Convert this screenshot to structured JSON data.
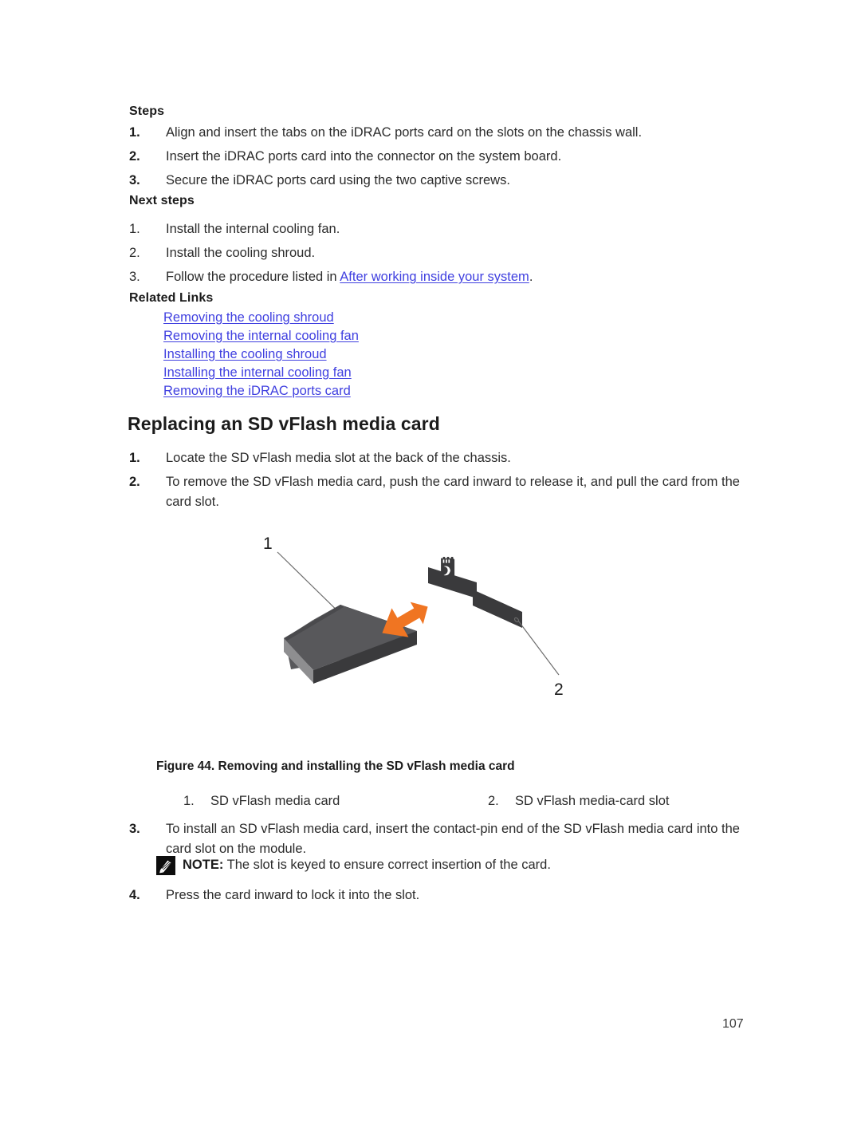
{
  "document": {
    "page_number": "107"
  },
  "steps_section": {
    "heading": "Steps",
    "items": [
      "Align and insert the tabs on the iDRAC ports card on the slots on the chassis wall.",
      "Insert the iDRAC ports card into the connector on the system board.",
      "Secure the iDRAC ports card using the two captive screws."
    ],
    "markers": [
      "1.",
      "2.",
      "3."
    ]
  },
  "next_steps_section": {
    "heading": "Next steps",
    "markers": [
      "1.",
      "2.",
      "3."
    ],
    "items": [
      "Install the internal cooling fan.",
      "Install the cooling shroud."
    ],
    "item3_prefix": "Follow the procedure listed in ",
    "item3_link": "After working inside your system",
    "item3_suffix": "."
  },
  "related_links": {
    "heading": "Related Links",
    "links": [
      "Removing the cooling shroud",
      "Removing the internal cooling fan",
      "Installing the cooling shroud",
      "Installing the internal cooling fan",
      "Removing the iDRAC ports card"
    ]
  },
  "section": {
    "title": "Replacing an SD vFlash media card",
    "markers": [
      "1.",
      "2.",
      "3.",
      "4."
    ],
    "step1": "Locate the SD vFlash media slot at the back of the chassis.",
    "step2": "To remove the SD vFlash media card, push the card inward to release it, and pull the card from the card slot.",
    "step3": "To install an SD vFlash media card, insert the contact-pin end of the SD vFlash media card into the card slot on the module.",
    "step4": "Press the card inward to lock it into the slot."
  },
  "note": {
    "label": "NOTE:",
    "text": " The slot is keyed to ensure correct insertion of the card.",
    "icon": "note-pencil-icon"
  },
  "figure": {
    "caption": "Figure 44. Removing and installing the SD vFlash media card",
    "callouts": [
      {
        "number": "1"
      },
      {
        "number": "2"
      }
    ],
    "legend": [
      {
        "marker": "1.",
        "label": "SD vFlash media card"
      },
      {
        "marker": "2.",
        "label": "SD vFlash media-card slot"
      }
    ],
    "icons": {
      "sd_card_glyph": "sd-card-icon",
      "arrow": "double-headed-arrow-icon"
    },
    "colors": {
      "card_top": "#58585b",
      "card_side": "#3a3a3c",
      "card_edge_light": "#8e8e90",
      "slot_bar": "#3a3a3c",
      "arrow_orange": "#f07522",
      "leader_line": "#6d6d6d"
    }
  }
}
